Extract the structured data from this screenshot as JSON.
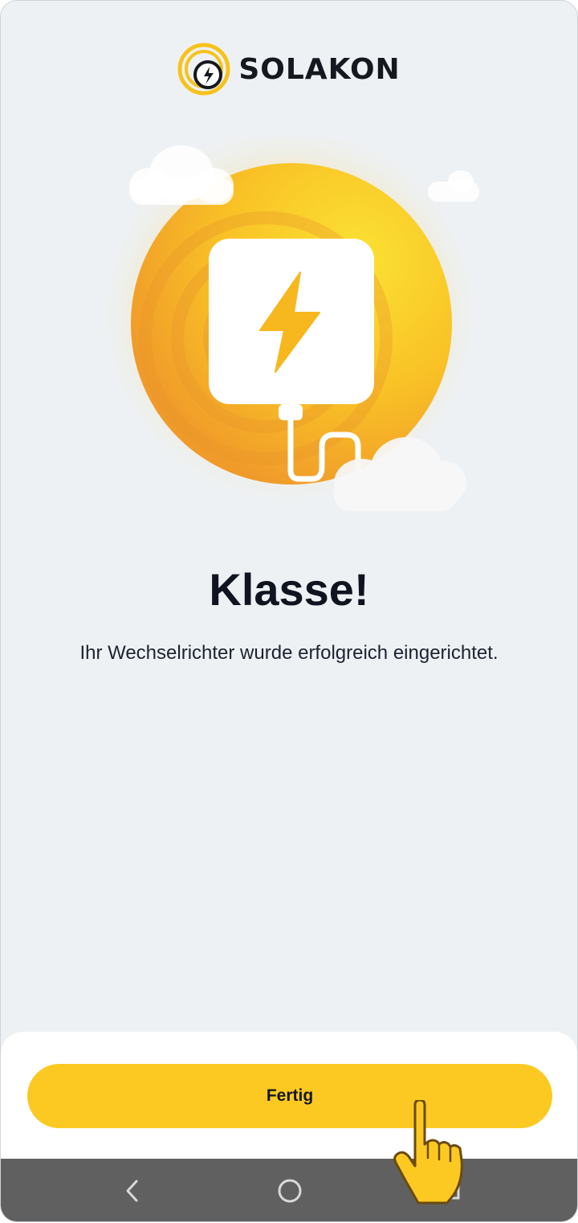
{
  "brand": {
    "name": "SOLAKON",
    "logo_icon": "solakon-logo-icon"
  },
  "illustration": {
    "icon": "inverter-lightning-icon",
    "colors": {
      "sun": "#f9c820",
      "accent": "#f0a21e"
    }
  },
  "success": {
    "headline": "Klasse!",
    "message": "Ihr Wechselrichter wurde erfolgreich eingerichtet."
  },
  "actions": {
    "done_label": "Fertig",
    "button_color": "#fcc922"
  },
  "system_nav": {
    "back_icon": "back-chevron-icon",
    "home_icon": "home-circle-icon",
    "recents_icon": "recents-icon"
  },
  "overlay": {
    "tap_icon": "pointing-hand-icon"
  }
}
